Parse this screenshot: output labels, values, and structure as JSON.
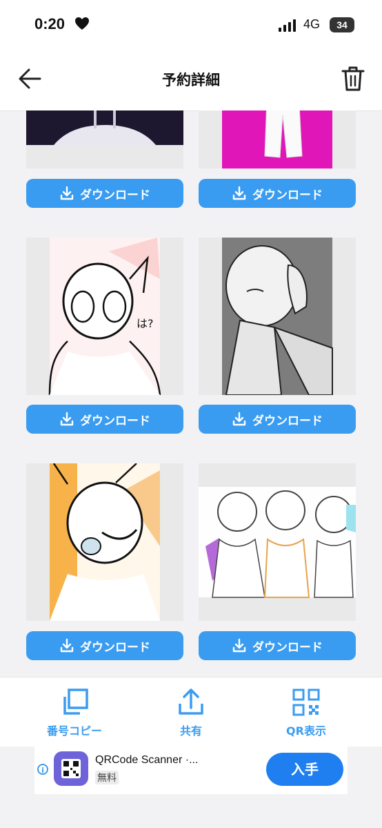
{
  "status": {
    "time": "0:20",
    "network": "4G",
    "battery": "34"
  },
  "header": {
    "title": "予約詳細"
  },
  "grid": {
    "download_label": "ダウンロード",
    "items": [
      {
        "col": 0,
        "row": 0
      },
      {
        "col": 1,
        "row": 0
      },
      {
        "col": 0,
        "row": 1
      },
      {
        "col": 1,
        "row": 1
      },
      {
        "col": 0,
        "row": 2
      },
      {
        "col": 1,
        "row": 2
      }
    ]
  },
  "toolbar": {
    "copy_label": "番号コピー",
    "share_label": "共有",
    "qr_label": "QR表示"
  },
  "ad": {
    "title": "QRCode Scanner ·...",
    "price": "無料",
    "get_label": "入手"
  },
  "colors": {
    "accent": "#3a9cf0",
    "ad_button": "#1f7ff0"
  }
}
